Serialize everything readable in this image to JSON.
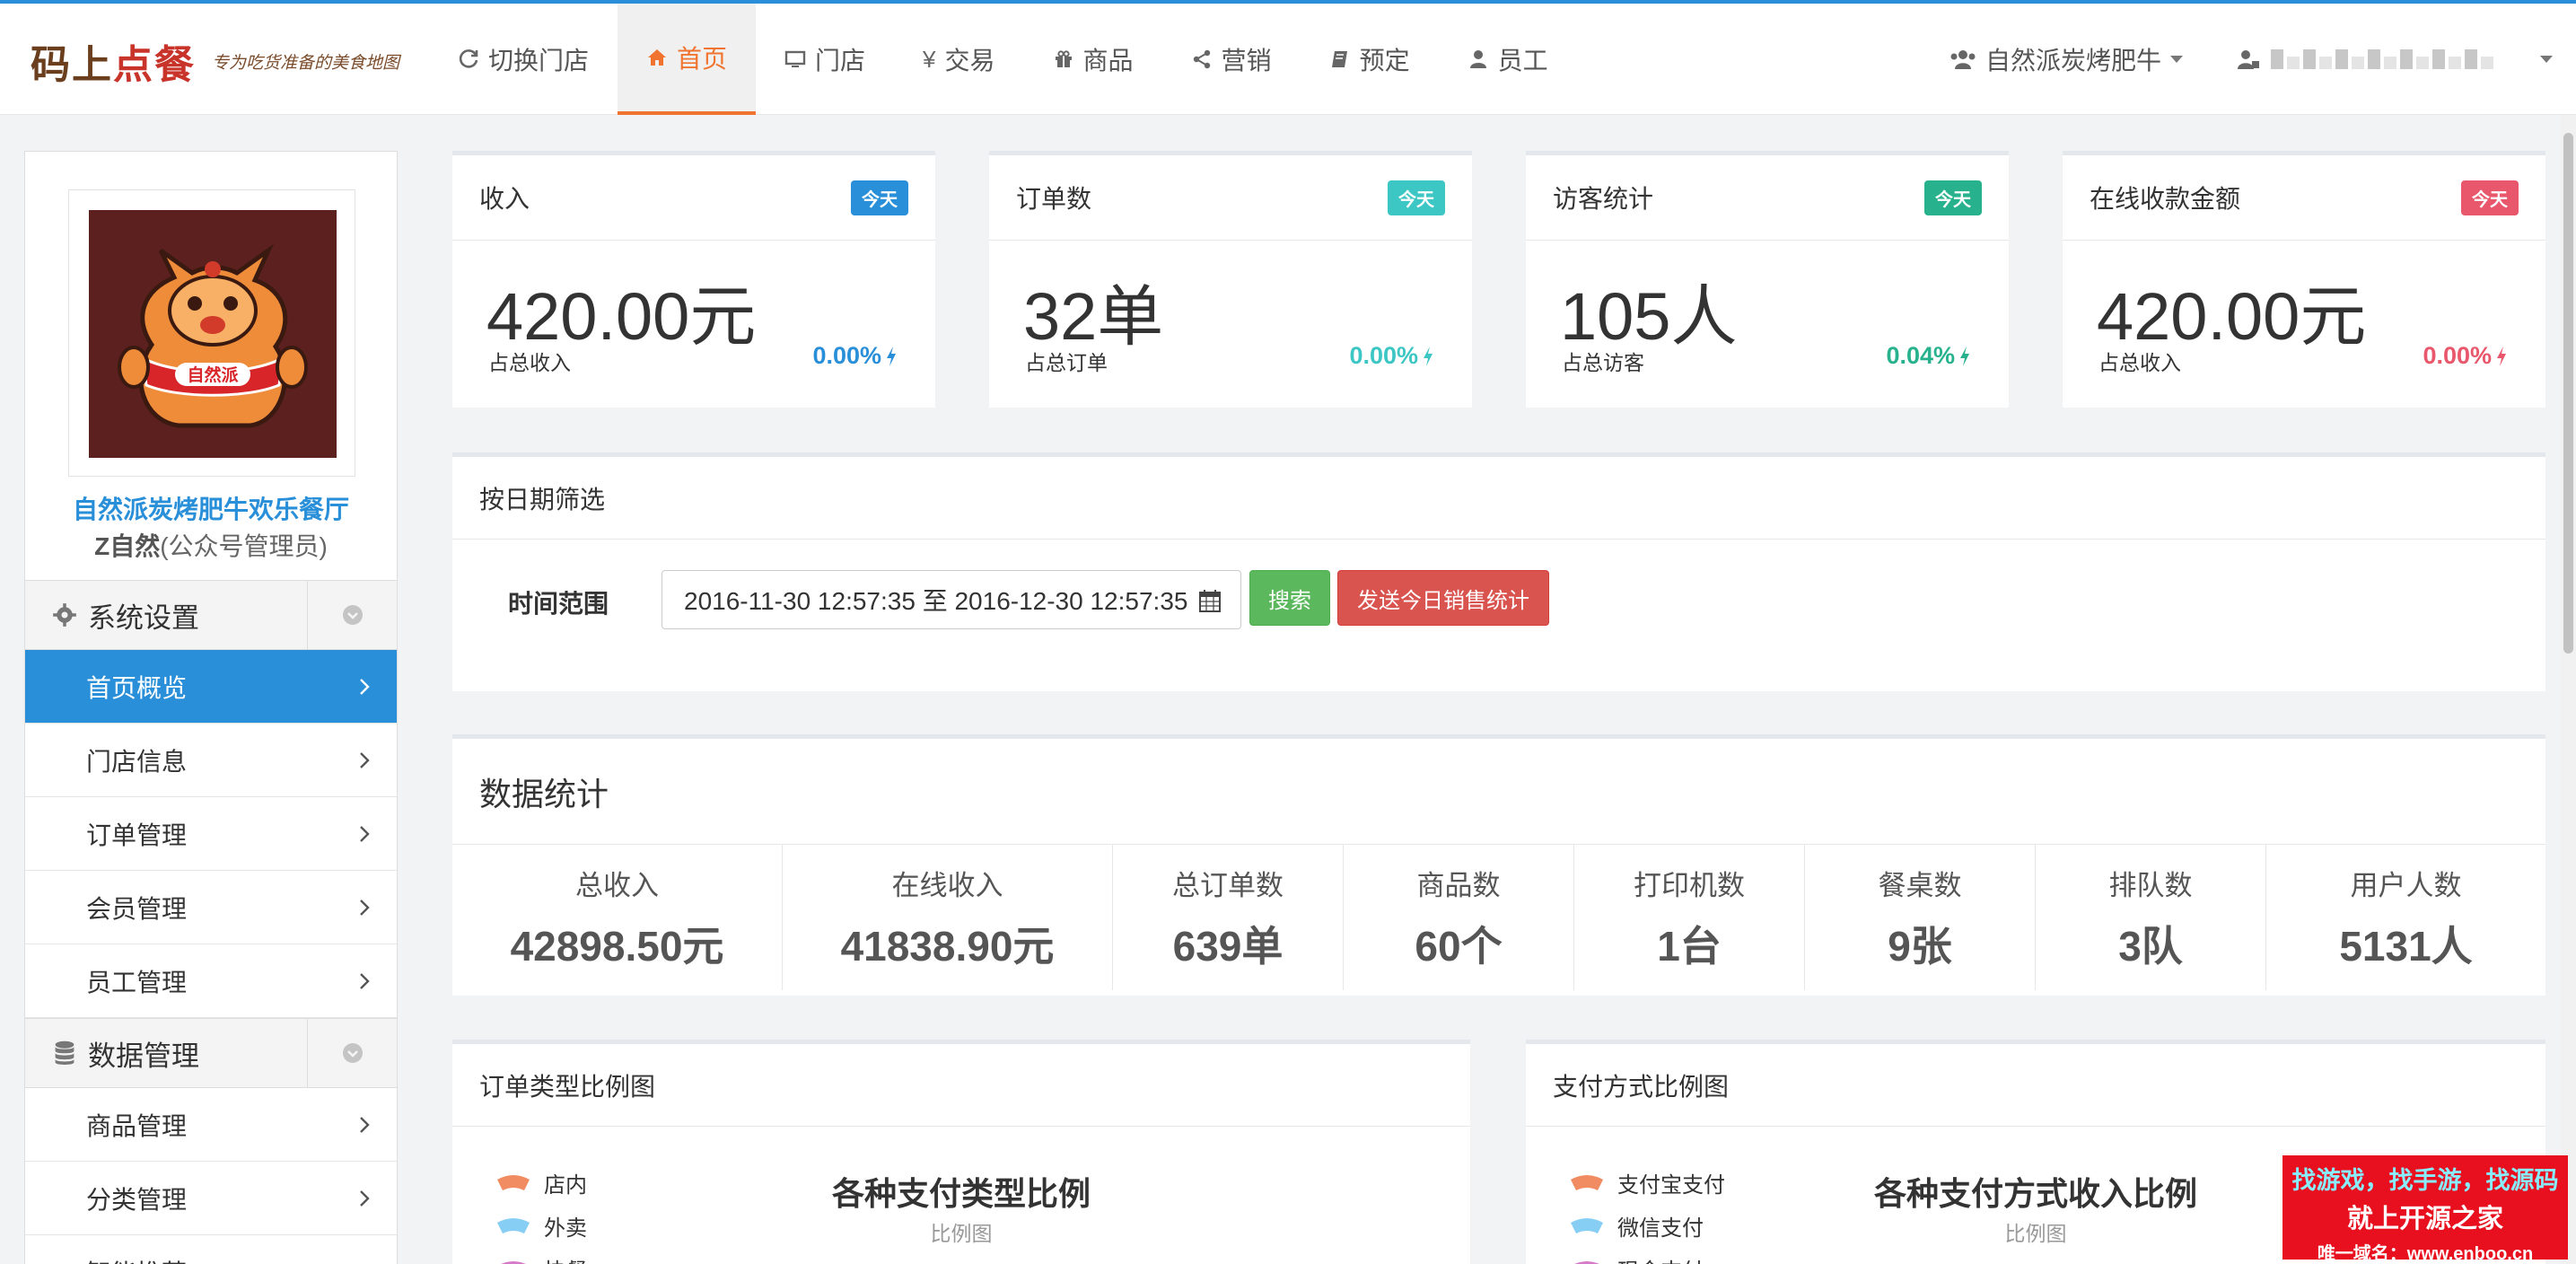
{
  "logo": {
    "mark_left": "码上",
    "mark_right": "点餐",
    "slogan": "专为吃货准备的美食地图"
  },
  "nav": [
    {
      "label": "切换门店",
      "icon": "refresh-icon",
      "active": false
    },
    {
      "label": "首页",
      "icon": "home-icon",
      "active": true
    },
    {
      "label": "门店",
      "icon": "monitor-icon",
      "active": false
    },
    {
      "label": "交易",
      "icon": "yen-icon",
      "active": false
    },
    {
      "label": "商品",
      "icon": "gift-icon",
      "active": false
    },
    {
      "label": "营销",
      "icon": "share-icon",
      "active": false
    },
    {
      "label": "预定",
      "icon": "book-icon",
      "active": false
    },
    {
      "label": "员工",
      "icon": "user-icon",
      "active": false
    }
  ],
  "nav_right": {
    "shop_label": "自然派炭烤肥牛"
  },
  "sidebar": {
    "shop_name": "自然派炭烤肥牛欢乐餐厅",
    "role_name": "Z自然",
    "role_desc": "(公众号管理员)",
    "groups": [
      {
        "label": "系统设置",
        "icon": "gear-icon"
      },
      {
        "label": "数据管理",
        "icon": "database-icon"
      }
    ],
    "items": [
      {
        "label": "首页概览",
        "active": true
      },
      {
        "label": "门店信息"
      },
      {
        "label": "订单管理"
      },
      {
        "label": "会员管理"
      },
      {
        "label": "员工管理"
      },
      {
        "label": "商品管理"
      },
      {
        "label": "分类管理"
      },
      {
        "label": "智能推荐"
      }
    ]
  },
  "cards": [
    {
      "title": "收入",
      "badge": "今天",
      "badge_color": "#2a8fd9",
      "value": "420.00元",
      "sub": "占总收入",
      "pct": "0.00%",
      "pct_color": "#2a8fd9"
    },
    {
      "title": "订单数",
      "badge": "今天",
      "badge_color": "#3cc6c4",
      "value": "32单",
      "sub": "占总订单",
      "pct": "0.00%",
      "pct_color": "#3cc6c4"
    },
    {
      "title": "访客统计",
      "badge": "今天",
      "badge_color": "#27b28d",
      "value": "105人",
      "sub": "占总访客",
      "pct": "0.04%",
      "pct_color": "#27b28d"
    },
    {
      "title": "在线收款金额",
      "badge": "今天",
      "badge_color": "#e8576b",
      "value": "420.00元",
      "sub": "占总收入",
      "pct": "0.00%",
      "pct_color": "#e8576b"
    }
  ],
  "filter": {
    "title": "按日期筛选",
    "range_label": "时间范围",
    "range_value": "2016-11-30 12:57:35 至 2016-12-30 12:57:35",
    "search_label": "搜索",
    "send_label": "发送今日销售统计"
  },
  "stats": {
    "title": "数据统计",
    "items": [
      {
        "label": "总收入",
        "value": "42898.50元"
      },
      {
        "label": "在线收入",
        "value": "41838.90元"
      },
      {
        "label": "总订单数",
        "value": "639单"
      },
      {
        "label": "商品数",
        "value": "60个"
      },
      {
        "label": "打印机数",
        "value": "1台"
      },
      {
        "label": "餐桌数",
        "value": "9张"
      },
      {
        "label": "排队数",
        "value": "3队"
      },
      {
        "label": "用户人数",
        "value": "5131人"
      }
    ]
  },
  "order_chart": {
    "panel_title": "订单类型比例图",
    "title": "各种支付类型比例",
    "subtitle": "比例图",
    "legend": [
      {
        "label": "店内",
        "color": "#f08b62"
      },
      {
        "label": "外卖",
        "color": "#87cef5"
      },
      {
        "label": "快餐",
        "color": "#d679c9"
      }
    ]
  },
  "payment_chart": {
    "panel_title": "支付方式比例图",
    "title": "各种支付方式收入比例",
    "subtitle": "比例图",
    "legend": [
      {
        "label": "支付宝支付",
        "color": "#f08b62"
      },
      {
        "label": "微信支付",
        "color": "#87cef5"
      },
      {
        "label": "现金支付",
        "color": "#d679c9"
      }
    ]
  },
  "watermark": {
    "line1": "找游戏，找手游，找源码",
    "line2": "就上开源之家",
    "line3": "唯一域名：www.enboo.cn"
  }
}
